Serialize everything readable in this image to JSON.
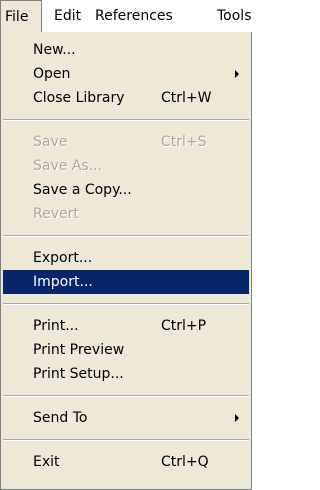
{
  "menubar": {
    "file": "File",
    "edit": "Edit",
    "references": "References",
    "tools": "Tools"
  },
  "menu": {
    "new": "New...",
    "open": "Open",
    "close_library": "Close Library",
    "close_library_shortcut": "Ctrl+W",
    "save": "Save",
    "save_shortcut": "Ctrl+S",
    "save_as": "Save As...",
    "save_copy": "Save a Copy...",
    "revert": "Revert",
    "export": "Export...",
    "import": "Import...",
    "print": "Print...",
    "print_shortcut": "Ctrl+P",
    "print_preview": "Print Preview",
    "print_setup": "Print Setup...",
    "send_to": "Send To",
    "exit": "Exit",
    "exit_shortcut": "Ctrl+Q"
  },
  "colors": {
    "menu_bg": "#ece9d8",
    "highlight_bg": "#0a246a",
    "disabled_text": "#aca899"
  },
  "icons": {
    "submenu": "chevron-right-icon"
  }
}
